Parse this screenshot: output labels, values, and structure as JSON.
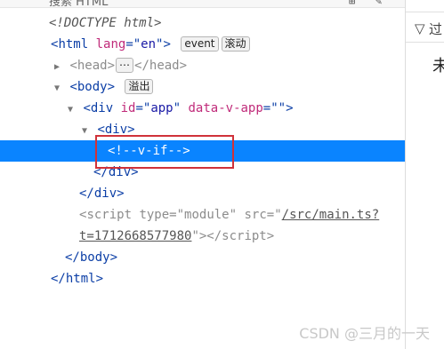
{
  "toolbar": {
    "search_placeholder": "搜索 HTML",
    "pick_icon": "⊞",
    "edit_icon": "✎"
  },
  "side_panel": {
    "filter_text": "过",
    "empty_text": "未"
  },
  "tree": {
    "doctype": "<!DOCTYPE html>",
    "html_open": {
      "tag": "html",
      "attr_name": "lang",
      "attr_value": "en",
      "badges": [
        "event",
        "滚动"
      ]
    },
    "head": {
      "open": "head",
      "ellipsis": "⋯",
      "close": "head"
    },
    "body_open": {
      "tag": "body",
      "badge": "溢出"
    },
    "div_app": {
      "tag": "div",
      "attr1_name": "id",
      "attr1_value": "app",
      "attr2_name": "data-v-app",
      "attr2_value": ""
    },
    "div_inner_open": "div",
    "comment": "<!--v-if-->",
    "div_inner_close": "div",
    "div_app_close": "div",
    "script": {
      "tag": "script",
      "type_name": "type",
      "type_value": "module",
      "src_name": "src",
      "src_line1": "/src/main.ts?",
      "src_line2": "t=1712668577980"
    },
    "body_close": "body",
    "html_close": "html"
  },
  "watermark": "CSDN @三月的一天"
}
